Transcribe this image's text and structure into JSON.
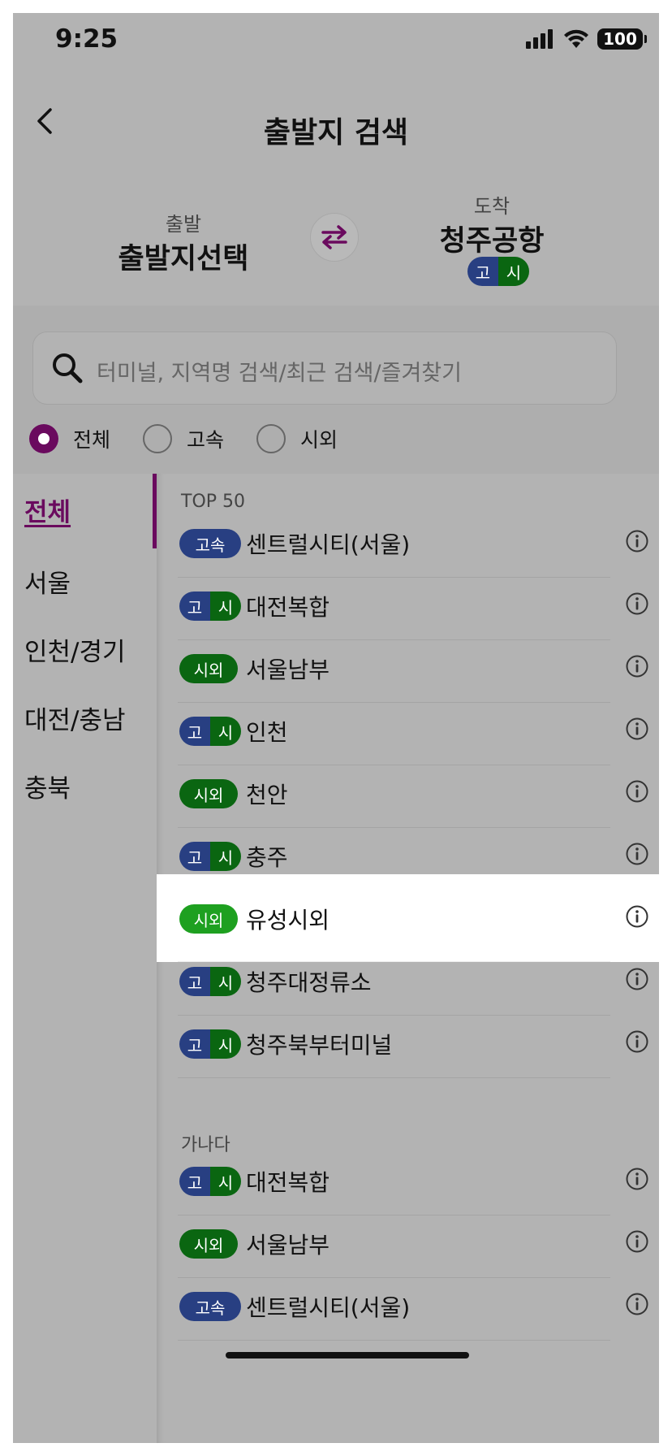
{
  "status": {
    "time": "9:25",
    "battery": "100"
  },
  "header": {
    "title": "출발지 검색"
  },
  "route": {
    "departure_label": "출발",
    "departure_value": "출발지선택",
    "arrival_label": "도착",
    "arrival_value": "청주공항",
    "arrival_badge": {
      "left": "고",
      "right": "시"
    }
  },
  "search": {
    "placeholder": "터미널, 지역명 검색/최근 검색/즐겨찾기"
  },
  "filters": [
    {
      "label": "전체",
      "selected": true
    },
    {
      "label": "고속",
      "selected": false
    },
    {
      "label": "시외",
      "selected": false
    }
  ],
  "categories": [
    {
      "label": "전체",
      "active": true
    },
    {
      "label": "서울",
      "active": false
    },
    {
      "label": "인천/경기",
      "active": false
    },
    {
      "label": "대전/충남",
      "active": false
    },
    {
      "label": "충북",
      "active": false
    }
  ],
  "sections": [
    {
      "title": "TOP 50",
      "rows": [
        {
          "badge": "express",
          "badge_text": "고속",
          "name": "센트럴시티(서울)"
        },
        {
          "badge": "both",
          "badge_left": "고",
          "badge_right": "시",
          "name": "대전복합"
        },
        {
          "badge": "intercity",
          "badge_text": "시외",
          "name": "서울남부"
        },
        {
          "badge": "both",
          "badge_left": "고",
          "badge_right": "시",
          "name": "인천"
        },
        {
          "badge": "intercity",
          "badge_text": "시외",
          "name": "천안"
        },
        {
          "badge": "both",
          "badge_left": "고",
          "badge_right": "시",
          "name": "충주"
        },
        {
          "badge": "intercity",
          "badge_text": "시외",
          "name": "유성시외",
          "highlighted": true
        },
        {
          "badge": "both",
          "badge_left": "고",
          "badge_right": "시",
          "name": "청주대정류소"
        },
        {
          "badge": "both",
          "badge_left": "고",
          "badge_right": "시",
          "name": "청주북부터미널"
        }
      ]
    },
    {
      "title": "가나다",
      "rows": [
        {
          "badge": "both",
          "badge_left": "고",
          "badge_right": "시",
          "name": "대전복합"
        },
        {
          "badge": "intercity",
          "badge_text": "시외",
          "name": "서울남부"
        },
        {
          "badge": "express",
          "badge_text": "고속",
          "name": "센트럴시티(서울)"
        }
      ]
    }
  ],
  "colors": {
    "accent": "#6a0a5e",
    "express": "#283f82",
    "intercity": "#0a6611",
    "intercity_highlight": "#1ea020"
  }
}
